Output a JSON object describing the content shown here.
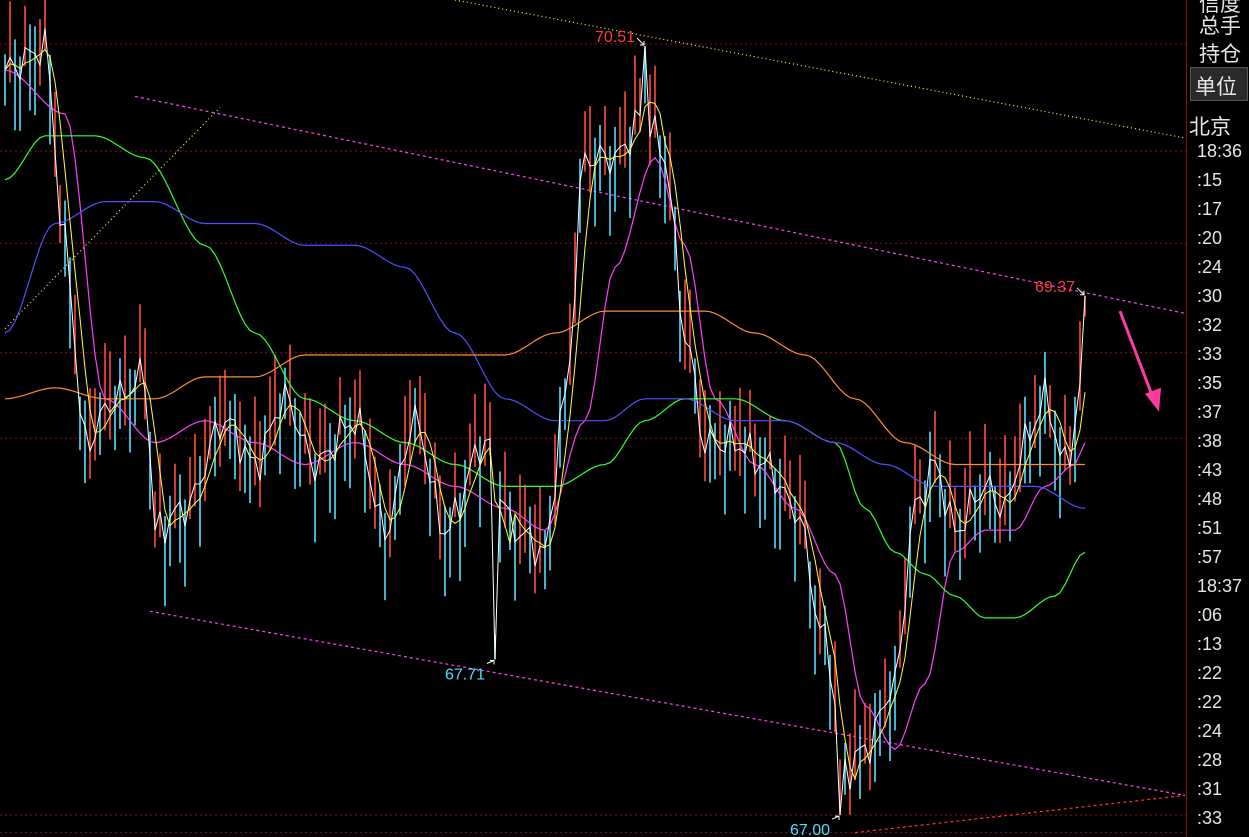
{
  "side_panel": {
    "labels_top": [
      "信度",
      "总手",
      "持仓"
    ],
    "unit_label": "单位",
    "city_label": "北京",
    "times": [
      "18:36",
      ":15",
      ":17",
      ":20",
      ":24",
      ":30",
      ":32",
      ":33",
      ":35",
      ":37",
      ":38",
      ":43",
      ":48",
      ":51",
      ":57",
      "18:37",
      ":06",
      ":13",
      ":22",
      ":22",
      ":24",
      ":28",
      ":31",
      ":33"
    ]
  },
  "chart_data": {
    "type": "line",
    "ylim": [
      66.9,
      70.72
    ],
    "price_markers": [
      {
        "label": "70.51",
        "index": 128,
        "value": 70.51,
        "color": "#ff3b3b",
        "kind": "high"
      },
      {
        "label": "69.37",
        "index": 216,
        "value": 69.37,
        "color": "#ff3b3b",
        "kind": "high"
      },
      {
        "label": "67.71",
        "index": 98,
        "value": 67.71,
        "color": "#4fe0ff",
        "kind": "low"
      },
      {
        "label": "67.00",
        "index": 167,
        "value": 67.0,
        "color": "#4fe0ff",
        "kind": "low"
      }
    ],
    "price_series_anchors": [
      [
        0,
        70.4
      ],
      [
        8,
        70.5
      ],
      [
        12,
        69.6
      ],
      [
        16,
        68.7
      ],
      [
        22,
        68.9
      ],
      [
        28,
        69.0
      ],
      [
        30,
        68.3
      ],
      [
        36,
        68.4
      ],
      [
        44,
        68.8
      ],
      [
        50,
        68.6
      ],
      [
        56,
        68.9
      ],
      [
        62,
        68.6
      ],
      [
        70,
        68.8
      ],
      [
        76,
        68.3
      ],
      [
        82,
        68.8
      ],
      [
        88,
        68.3
      ],
      [
        96,
        68.7
      ],
      [
        102,
        68.3
      ],
      [
        108,
        68.2
      ],
      [
        112,
        68.9
      ],
      [
        116,
        70.0
      ],
      [
        122,
        70.0
      ],
      [
        128,
        70.2
      ],
      [
        132,
        70.0
      ],
      [
        136,
        69.2
      ],
      [
        140,
        68.7
      ],
      [
        146,
        68.7
      ],
      [
        152,
        68.6
      ],
      [
        158,
        68.4
      ],
      [
        164,
        67.8
      ],
      [
        168,
        67.2
      ],
      [
        172,
        67.3
      ],
      [
        178,
        67.6
      ],
      [
        182,
        68.4
      ],
      [
        186,
        68.6
      ],
      [
        190,
        68.3
      ],
      [
        196,
        68.5
      ],
      [
        200,
        68.4
      ],
      [
        204,
        68.7
      ],
      [
        208,
        68.9
      ],
      [
        212,
        68.6
      ],
      [
        216,
        69.0
      ]
    ],
    "ma_series": [
      {
        "name": "MA-pink",
        "color": "#ff40ff",
        "anchors": [
          [
            0,
            70.4
          ],
          [
            12,
            70.2
          ],
          [
            20,
            68.9
          ],
          [
            30,
            68.7
          ],
          [
            40,
            68.8
          ],
          [
            50,
            68.7
          ],
          [
            60,
            68.6
          ],
          [
            70,
            68.7
          ],
          [
            80,
            68.6
          ],
          [
            90,
            68.5
          ],
          [
            100,
            68.4
          ],
          [
            108,
            68.3
          ],
          [
            116,
            68.8
          ],
          [
            122,
            69.5
          ],
          [
            130,
            70.0
          ],
          [
            136,
            69.6
          ],
          [
            142,
            68.9
          ],
          [
            150,
            68.6
          ],
          [
            158,
            68.4
          ],
          [
            166,
            68.1
          ],
          [
            172,
            67.5
          ],
          [
            178,
            67.3
          ],
          [
            184,
            67.6
          ],
          [
            190,
            68.2
          ],
          [
            196,
            68.3
          ],
          [
            202,
            68.3
          ],
          [
            208,
            68.5
          ],
          [
            214,
            68.6
          ],
          [
            216,
            68.7
          ]
        ]
      },
      {
        "name": "MA-green",
        "color": "#33ff33",
        "anchors": [
          [
            0,
            69.9
          ],
          [
            8,
            70.1
          ],
          [
            18,
            70.1
          ],
          [
            28,
            70.0
          ],
          [
            40,
            69.6
          ],
          [
            50,
            69.2
          ],
          [
            60,
            68.9
          ],
          [
            70,
            68.8
          ],
          [
            80,
            68.7
          ],
          [
            90,
            68.6
          ],
          [
            100,
            68.5
          ],
          [
            110,
            68.5
          ],
          [
            120,
            68.6
          ],
          [
            128,
            68.8
          ],
          [
            136,
            68.9
          ],
          [
            146,
            68.9
          ],
          [
            156,
            68.8
          ],
          [
            166,
            68.7
          ],
          [
            172,
            68.4
          ],
          [
            178,
            68.2
          ],
          [
            184,
            68.1
          ],
          [
            190,
            68.0
          ],
          [
            196,
            67.9
          ],
          [
            202,
            67.9
          ],
          [
            210,
            68.0
          ],
          [
            216,
            68.2
          ]
        ]
      },
      {
        "name": "MA-blue",
        "color": "#5050ff",
        "anchors": [
          [
            0,
            69.2
          ],
          [
            10,
            69.7
          ],
          [
            20,
            69.8
          ],
          [
            30,
            69.8
          ],
          [
            40,
            69.7
          ],
          [
            50,
            69.7
          ],
          [
            60,
            69.6
          ],
          [
            70,
            69.6
          ],
          [
            80,
            69.5
          ],
          [
            90,
            69.2
          ],
          [
            100,
            68.9
          ],
          [
            110,
            68.8
          ],
          [
            120,
            68.8
          ],
          [
            128,
            68.9
          ],
          [
            136,
            68.9
          ],
          [
            146,
            68.8
          ],
          [
            156,
            68.8
          ],
          [
            166,
            68.7
          ],
          [
            176,
            68.6
          ],
          [
            186,
            68.5
          ],
          [
            196,
            68.5
          ],
          [
            206,
            68.5
          ],
          [
            216,
            68.4
          ]
        ]
      },
      {
        "name": "MA-orange",
        "color": "#ff8c33",
        "anchors": [
          [
            0,
            68.9
          ],
          [
            10,
            68.95
          ],
          [
            20,
            68.9
          ],
          [
            30,
            68.9
          ],
          [
            40,
            69.0
          ],
          [
            50,
            69.0
          ],
          [
            60,
            69.1
          ],
          [
            70,
            69.1
          ],
          [
            80,
            69.1
          ],
          [
            90,
            69.1
          ],
          [
            100,
            69.1
          ],
          [
            110,
            69.2
          ],
          [
            120,
            69.3
          ],
          [
            130,
            69.3
          ],
          [
            140,
            69.3
          ],
          [
            150,
            69.2
          ],
          [
            160,
            69.1
          ],
          [
            170,
            68.9
          ],
          [
            180,
            68.7
          ],
          [
            190,
            68.6
          ],
          [
            200,
            68.6
          ],
          [
            210,
            68.6
          ],
          [
            216,
            68.6
          ]
        ]
      }
    ],
    "channels": [
      {
        "name": "upper-trend",
        "color": "#ffff33",
        "style": "dotted",
        "from": [
          90,
          70.72
        ],
        "to": [
          236,
          70.09
        ]
      },
      {
        "name": "channel-upper",
        "color": "#ff40ff",
        "style": "dashed",
        "from": [
          26,
          70.28
        ],
        "to": [
          236,
          69.29
        ]
      },
      {
        "name": "channel-lower",
        "color": "#ff40ff",
        "style": "dashed",
        "from": [
          29,
          67.93
        ],
        "to": [
          236,
          67.09
        ]
      },
      {
        "name": "left-support",
        "color": "#ffff33",
        "style": "dotted",
        "from": [
          0,
          69.22
        ],
        "to": [
          43,
          70.23
        ]
      },
      {
        "name": "bottom-line",
        "color": "#ff3333",
        "style": "dashed",
        "from": [
          170,
          66.92
        ],
        "to": [
          236,
          67.09
        ]
      }
    ],
    "reference_levels": [
      70.52,
      70.03,
      69.61,
      69.11,
      68.72,
      67.0,
      66.92
    ],
    "annotation_arrow": {
      "color": "#ff3aa0",
      "from": [
        223,
        69.3
      ],
      "to": [
        230,
        68.85
      ]
    }
  }
}
